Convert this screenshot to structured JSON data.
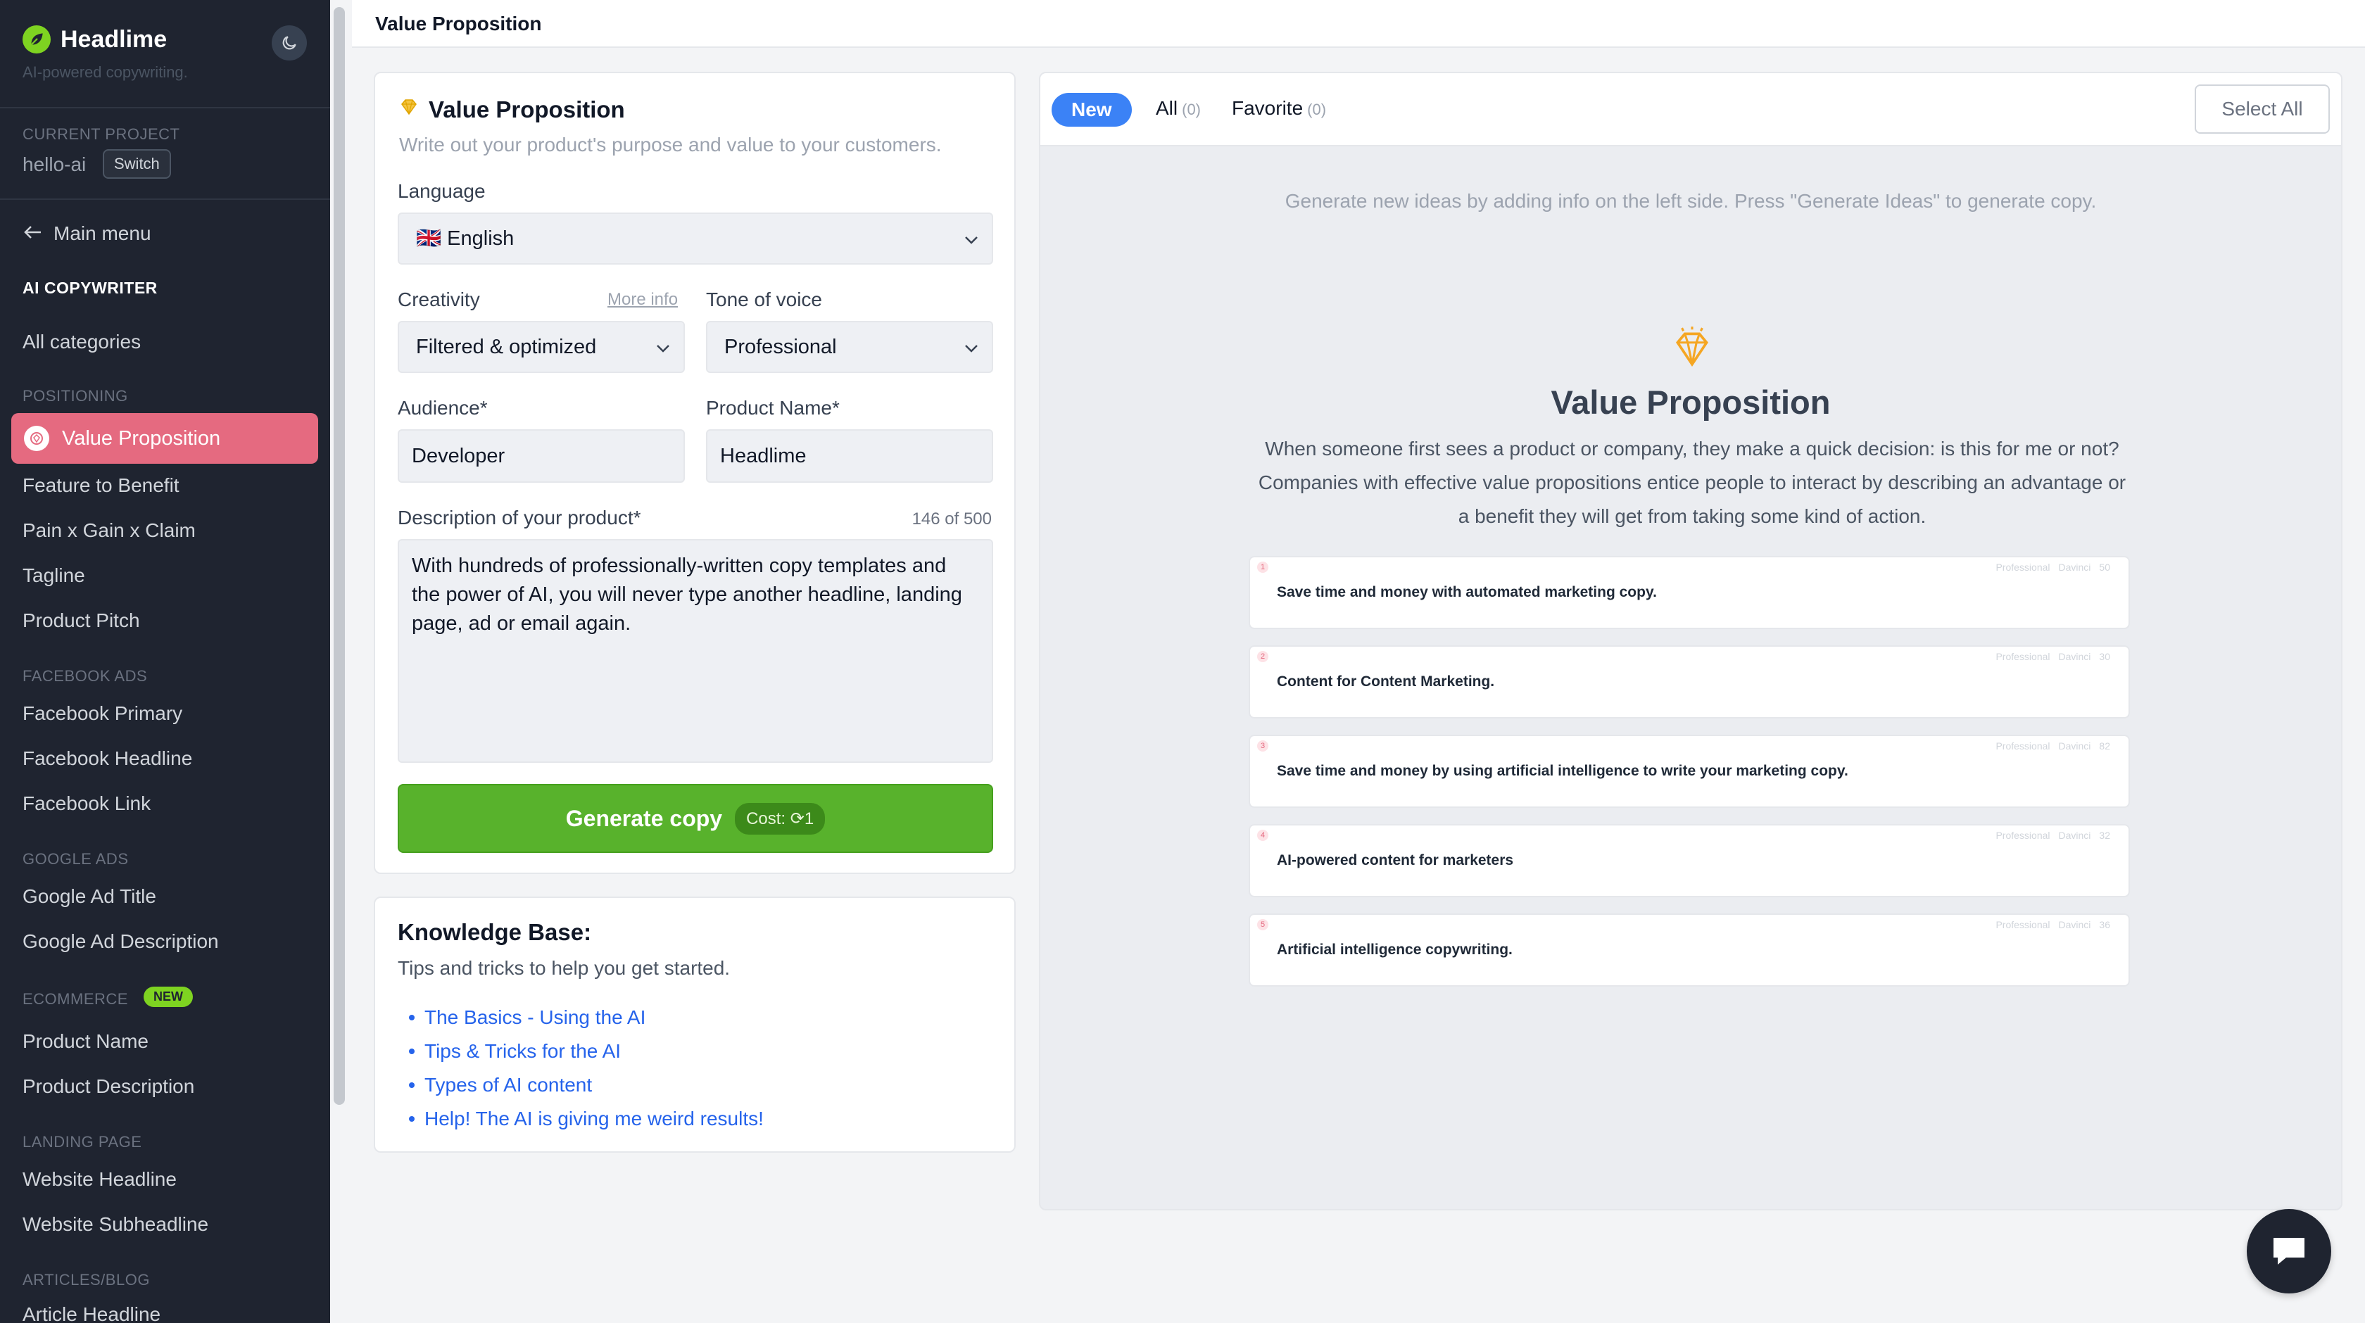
{
  "sidebar": {
    "brand": "Headlime",
    "tagline": "AI-powered copywriting.",
    "current_project_label": "CURRENT PROJECT",
    "project_name": "hello-ai",
    "switch_label": "Switch",
    "main_menu_label": "Main menu",
    "ai_copywriter_label": "AI COPYWRITER",
    "all_categories_label": "All categories",
    "sections": {
      "positioning": "POSITIONING",
      "facebook_ads": "FACEBOOK ADS",
      "google_ads": "GOOGLE ADS",
      "ecommerce": "ECOMMERCE",
      "ecommerce_badge": "NEW",
      "landing_page": "LANDING PAGE",
      "articles_blog": "ARTICLES/BLOG"
    },
    "items": {
      "value_proposition": "Value Proposition",
      "feature_to_benefit": "Feature to Benefit",
      "pain_gain_claim": "Pain x Gain x Claim",
      "tagline": "Tagline",
      "product_pitch": "Product Pitch",
      "facebook_primary": "Facebook Primary",
      "facebook_headline": "Facebook Headline",
      "facebook_link": "Facebook Link",
      "google_ad_title": "Google Ad Title",
      "google_ad_description": "Google Ad Description",
      "product_name": "Product Name",
      "product_description": "Product Description",
      "website_headline": "Website Headline",
      "website_subheadline": "Website Subheadline",
      "article_headline": "Article Headline"
    }
  },
  "header": {
    "title": "Value Proposition"
  },
  "form": {
    "title": "Value Proposition",
    "subtitle": "Write out your product's purpose and value to your customers.",
    "language_label": "Language",
    "language_value": "🇬🇧 English",
    "creativity_label": "Creativity",
    "more_info": "More info",
    "creativity_value": "Filtered & optimized",
    "tone_label": "Tone of voice",
    "tone_value": "Professional",
    "audience_label": "Audience*",
    "audience_value": "Developer",
    "product_name_label": "Product Name*",
    "product_name_value": "Headlime",
    "description_label": "Description of your product*",
    "description_counter": "146 of 500",
    "description_value": "With hundreds of professionally-written copy templates and the power of AI, you will never type another headline, landing page, ad or email again.",
    "generate_label": "Generate copy",
    "cost_label": "Cost: ⟳1"
  },
  "knowledge_base": {
    "title": "Knowledge Base:",
    "subtitle": "Tips and tricks to help you get started.",
    "links": [
      "The Basics - Using the AI",
      "Tips & Tricks for the AI",
      "Types of AI content",
      "Help! The AI is giving me weird results!"
    ]
  },
  "results": {
    "tab_new": "New",
    "tab_all": "All",
    "tab_all_count": "(0)",
    "tab_favorite": "Favorite",
    "tab_favorite_count": "(0)",
    "select_all": "Select All",
    "hint": "Generate new ideas by adding info on the left side. Press \"Generate Ideas\" to generate copy.",
    "vp_title": "Value Proposition",
    "vp_description": "When someone first sees a product or company, they make a quick decision: is this for me or not? Companies with effective value propositions entice people to interact by describing an advantage or a benefit they will get from taking some kind of action.",
    "ideas": [
      {
        "text": "Save time and money with automated marketing copy.",
        "tone": "Professional",
        "engine": "Davinci",
        "count": "50"
      },
      {
        "text": "Content for Content Marketing.",
        "tone": "Professional",
        "engine": "Davinci",
        "count": "30"
      },
      {
        "text": "Save time and money by using artificial intelligence to write your marketing copy.",
        "tone": "Professional",
        "engine": "Davinci",
        "count": "82"
      },
      {
        "text": "AI-powered content for marketers",
        "tone": "Professional",
        "engine": "Davinci",
        "count": "32"
      },
      {
        "text": "Artificial intelligence copywriting.",
        "tone": "Professional",
        "engine": "Davinci",
        "count": "36"
      }
    ]
  },
  "colors": {
    "sidebar_bg": "#1f2430",
    "active_nav": "#e56a80",
    "generate_btn": "#58b22c",
    "tab_active": "#3b82f6",
    "link": "#2563eb",
    "accent_gold": "#f5a623"
  },
  "icons": [
    "leaf-logo-icon",
    "moon-icon",
    "arrow-left-icon",
    "value-proposition-icon",
    "chevron-down-icon",
    "refresh-icon",
    "diamond-icon",
    "chat-icon"
  ]
}
